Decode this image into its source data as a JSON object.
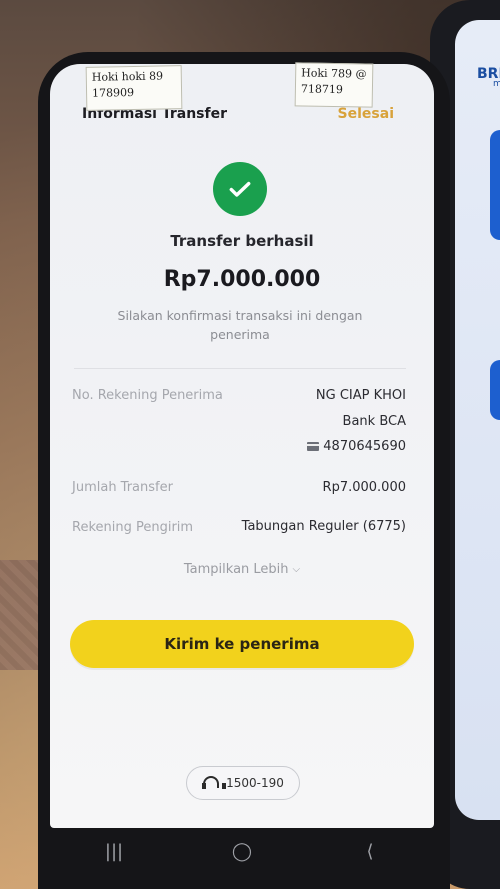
{
  "header": {
    "title": "Informasi Transfer",
    "done_label": "Selesai"
  },
  "status": {
    "title": "Transfer berhasil",
    "amount": "Rp7.000.000",
    "subtitle": "Silakan konfirmasi transaksi ini dengan penerima"
  },
  "details": {
    "recipient_label": "No. Rekening Penerima",
    "recipient_name": "NG CIAP KHOI",
    "recipient_bank": "Bank BCA",
    "recipient_account": "4870645690",
    "amount_label": "Jumlah Transfer",
    "amount_value": "Rp7.000.000",
    "sender_label": "Rekening Pengirim",
    "sender_value": "Tabungan Reguler (6775)"
  },
  "show_more_label": "Tampilkan Lebih",
  "cta_label": "Kirim ke penerima",
  "support_number": "1500-190",
  "notes": [
    {
      "line1": "Hoki hoki 89",
      "line2": "178909"
    },
    {
      "line1": "Hoki 789 @",
      "line2": "718719"
    }
  ],
  "background_phone": {
    "brand": "BRI",
    "sub": "mo"
  },
  "colors": {
    "accent_yellow": "#f2d21c",
    "success_green": "#1aa04e",
    "done_orange": "#d8a23a"
  }
}
